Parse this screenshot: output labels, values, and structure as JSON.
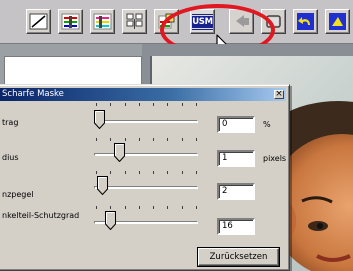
{
  "toolbar": {
    "buttons": [
      {
        "name": "tone-curve-icon"
      },
      {
        "name": "color-balance-icon"
      },
      {
        "name": "color-balance-alt-icon"
      },
      {
        "name": "variations-grid-icon"
      },
      {
        "name": "color-adjust-icon"
      },
      {
        "name": "unsharp-mask-icon",
        "label": "USM"
      },
      {
        "name": "back-icon"
      },
      {
        "name": "window-icon"
      },
      {
        "name": "undo-icon"
      },
      {
        "name": "extra-icon"
      }
    ],
    "highlight_color": "#e01822",
    "usm_color": "#18218c"
  },
  "dialog": {
    "title": "Scharfe Maske",
    "close_glyph": "×",
    "rows": [
      {
        "label": "trag",
        "value": "0",
        "unit": "%",
        "level": 0
      },
      {
        "label": "dius",
        "value": "1",
        "unit": "pixels",
        "level": 0.22
      },
      {
        "label": "nzpegel",
        "value": "2",
        "unit": "",
        "level": 0.03
      },
      {
        "label": "nkelteil-Schutzgrad",
        "value": "16",
        "unit": "",
        "level": 0.12
      }
    ],
    "reset_label": "Zurücksetzen",
    "titlebar_color": "#0a246a"
  }
}
